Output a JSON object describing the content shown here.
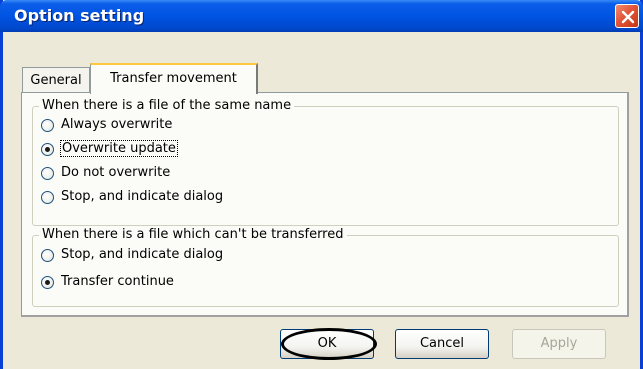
{
  "window": {
    "title": "Option setting"
  },
  "tabs": [
    {
      "label": "General",
      "active": false
    },
    {
      "label": "Transfer movement",
      "active": true
    }
  ],
  "group_same_name": {
    "label": "When there is a file of the same name",
    "options": [
      {
        "label": "Always overwrite",
        "selected": false
      },
      {
        "label": "Overwrite update",
        "selected": true
      },
      {
        "label": "Do not overwrite",
        "selected": false
      },
      {
        "label": "Stop, and indicate dialog",
        "selected": false
      }
    ]
  },
  "group_cant_transfer": {
    "label": "When there is a file which can't be transferred",
    "options": [
      {
        "label": "Stop, and indicate dialog",
        "selected": false
      },
      {
        "label": "Transfer continue",
        "selected": true
      }
    ]
  },
  "buttons": {
    "ok": "OK",
    "cancel": "Cancel",
    "apply": "Apply"
  },
  "colors": {
    "title_bar": "#0054e3",
    "close_button": "#e2553a",
    "annotation": "#000000"
  }
}
